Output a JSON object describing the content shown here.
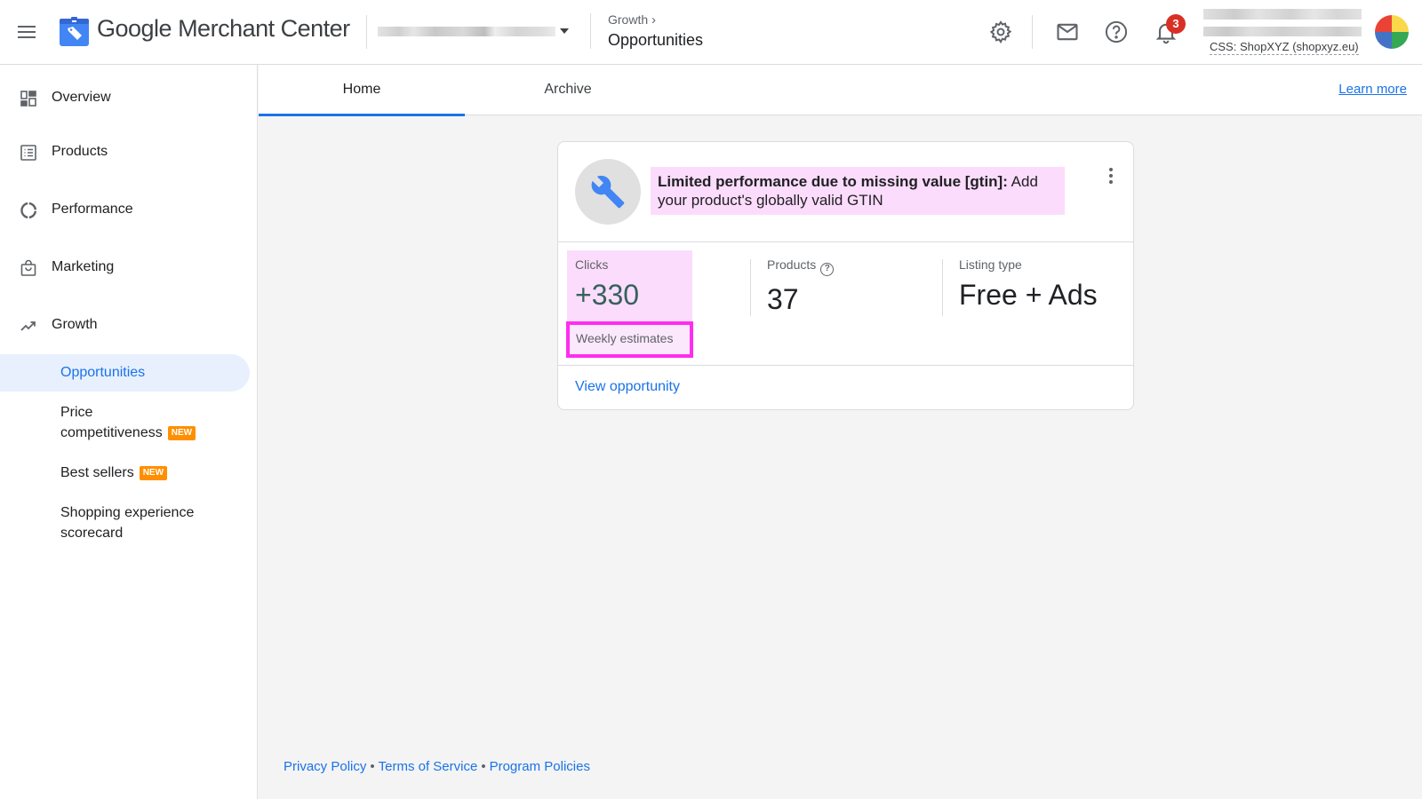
{
  "header": {
    "app_title": "Google Merchant Center",
    "account_picker_value": "",
    "breadcrumb_parent": "Growth",
    "breadcrumb_current": "Opportunities",
    "notification_count": "3",
    "user_css_label": "CSS: ShopXYZ (shopxyz.eu)",
    "icons": [
      "menu-icon",
      "merchant-center-logo-icon",
      "settings-icon",
      "mail-icon",
      "help-icon",
      "notifications-icon",
      "avatar"
    ]
  },
  "sidebar": {
    "items": [
      {
        "label": "Overview",
        "icon": "overview-icon"
      },
      {
        "label": "Products",
        "icon": "products-icon"
      },
      {
        "label": "Performance",
        "icon": "performance-icon"
      },
      {
        "label": "Marketing",
        "icon": "marketing-icon"
      },
      {
        "label": "Growth",
        "icon": "growth-icon"
      }
    ],
    "sub_items": [
      {
        "label": "Opportunities",
        "active": true
      },
      {
        "label_line1": "Price",
        "label_line2": "competitiveness",
        "badge": "NEW"
      },
      {
        "label": "Best sellers",
        "badge": "NEW"
      },
      {
        "label_line1": "Shopping experience",
        "label_line2": "scorecard"
      }
    ]
  },
  "tabs": {
    "items": [
      {
        "label": "Home",
        "active": true
      },
      {
        "label": "Archive",
        "active": false
      }
    ],
    "learn_more": "Learn more"
  },
  "card": {
    "icon": "wrench-icon",
    "title_bold": "Limited performance due to missing value [gtin]:",
    "title_rest": " Add your product's globally valid GTIN",
    "metrics": [
      {
        "label": "Clicks",
        "value": "+330",
        "note": "Weekly estimates"
      },
      {
        "label": "Products",
        "value": "37",
        "help": "?"
      },
      {
        "label": "Listing type",
        "value": "Free + Ads"
      }
    ],
    "action_link": "View opportunity"
  },
  "footer": {
    "links": [
      "Privacy Policy",
      "Terms of Service",
      "Program Policies"
    ],
    "separator": "•"
  },
  "colors": {
    "accent": "#1a73e8",
    "highlight_fill": "#fcdcfc",
    "highlight_border": "#ff2df0",
    "new_badge": "#ff8f00",
    "notification_badge": "#d93025"
  }
}
